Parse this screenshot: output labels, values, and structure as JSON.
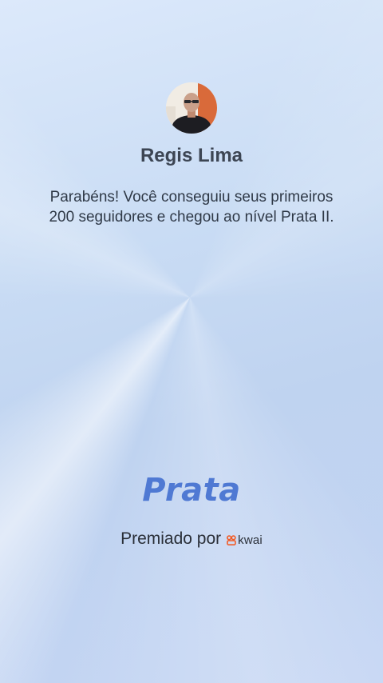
{
  "profile": {
    "name": "Regis Lima"
  },
  "message": "Parabéns! Você conseguiu seus primeiros 200 seguidores e chegou ao nível Prata II.",
  "badge": {
    "level_name": "Prata"
  },
  "footer": {
    "awarded_by": "Premiado por",
    "brand": "kwai",
    "brand_icon": "kwai-logo-icon"
  },
  "colors": {
    "level_text": "#4f79d3",
    "brand_mark": "#f25a24",
    "background_top": "#dce9fb",
    "background_bottom": "#c3d4f3"
  }
}
